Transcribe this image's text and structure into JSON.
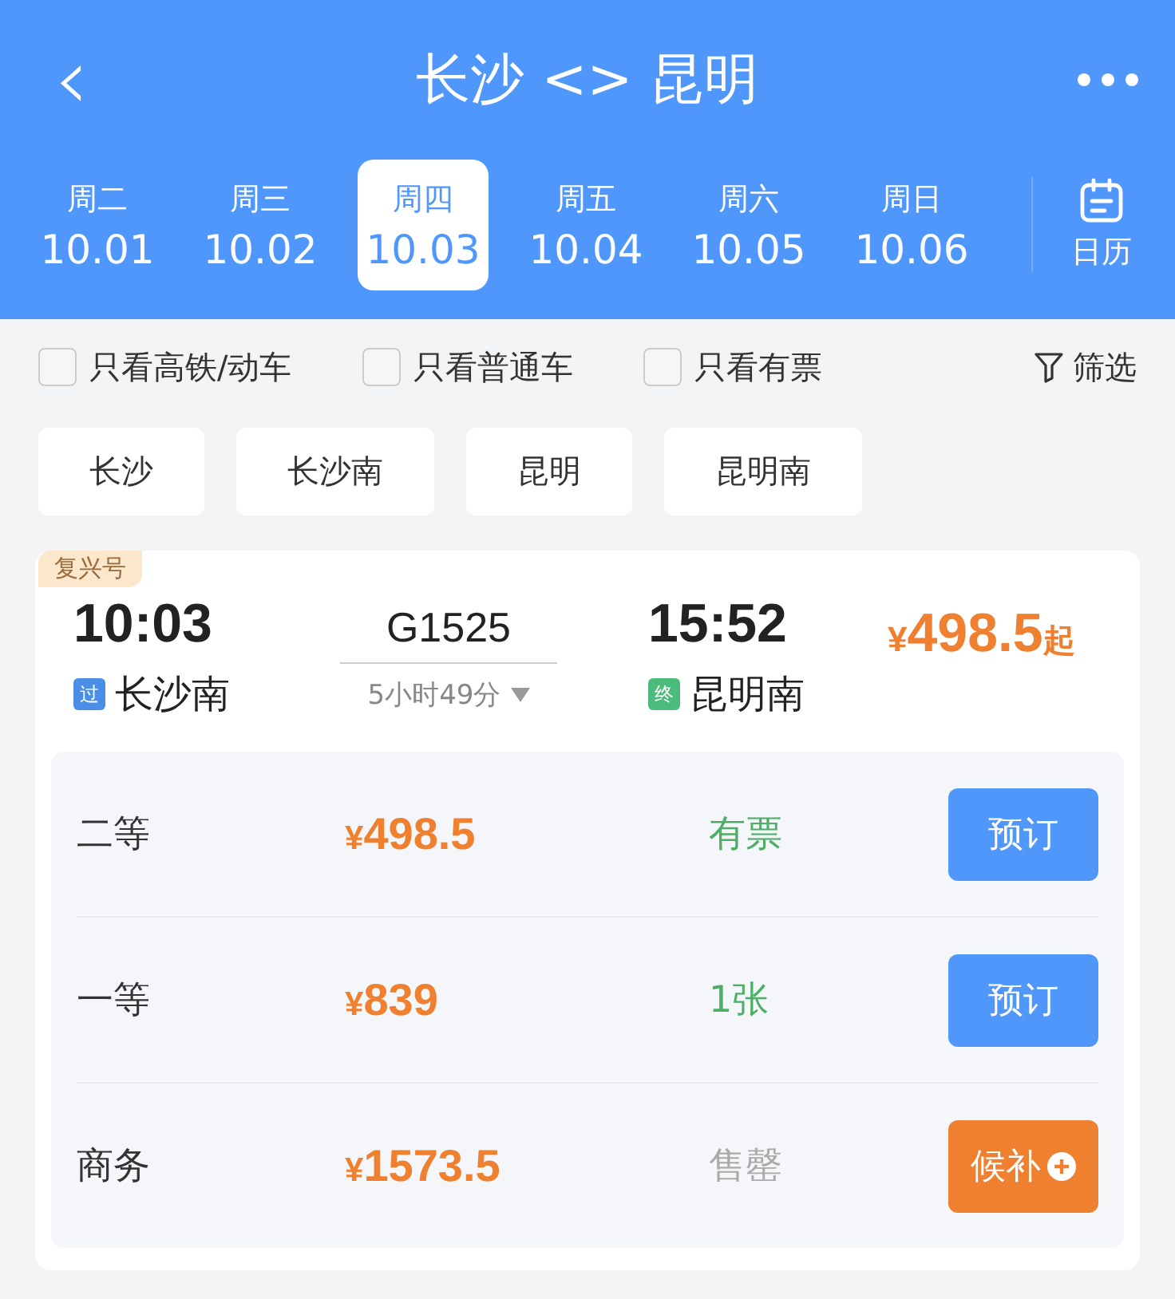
{
  "header": {
    "title": "长沙 <> 昆明",
    "back": "‹"
  },
  "dates": [
    {
      "weekday": "周二",
      "date": "10.01",
      "selected": false
    },
    {
      "weekday": "周三",
      "date": "10.02",
      "selected": false
    },
    {
      "weekday": "周四",
      "date": "10.03",
      "selected": true
    },
    {
      "weekday": "周五",
      "date": "10.04",
      "selected": false
    },
    {
      "weekday": "周六",
      "date": "10.05",
      "selected": false
    },
    {
      "weekday": "周日",
      "date": "10.06",
      "selected": false
    }
  ],
  "calendar": {
    "label": "日历"
  },
  "filters": [
    {
      "label": "只看高铁/动车",
      "checked": false
    },
    {
      "label": "只看普通车",
      "checked": false
    },
    {
      "label": "只看有票",
      "checked": false
    }
  ],
  "filter_button": {
    "label": "筛选"
  },
  "stations": [
    {
      "label": "长沙"
    },
    {
      "label": "长沙南"
    },
    {
      "label": "昆明"
    },
    {
      "label": "昆明南"
    }
  ],
  "train": {
    "tag": "复兴号",
    "depart_time": "10:03",
    "number": "G1525",
    "arrive_time": "15:52",
    "duration": "5小时49分",
    "from": {
      "badge": "过",
      "color": "#4a8ee8",
      "name": "长沙南"
    },
    "to": {
      "badge": "终",
      "color": "#4cbc7c",
      "name": "昆明南"
    },
    "price": {
      "currency": "¥",
      "amount": "498.5",
      "suffix": "起"
    },
    "seats": [
      {
        "class": "二等",
        "currency": "¥",
        "amount": "498.5",
        "availability": "有票",
        "kind": "available",
        "button": {
          "label": "预订",
          "kind": "book"
        }
      },
      {
        "class": "一等",
        "currency": "¥",
        "amount": "839",
        "availability": "1张",
        "kind": "available",
        "button": {
          "label": "预订",
          "kind": "book"
        }
      },
      {
        "class": "商务",
        "currency": "¥",
        "amount": "1573.5",
        "availability": "售罄",
        "kind": "soldout",
        "button": {
          "label": "候补",
          "kind": "waitlist"
        }
      }
    ]
  }
}
